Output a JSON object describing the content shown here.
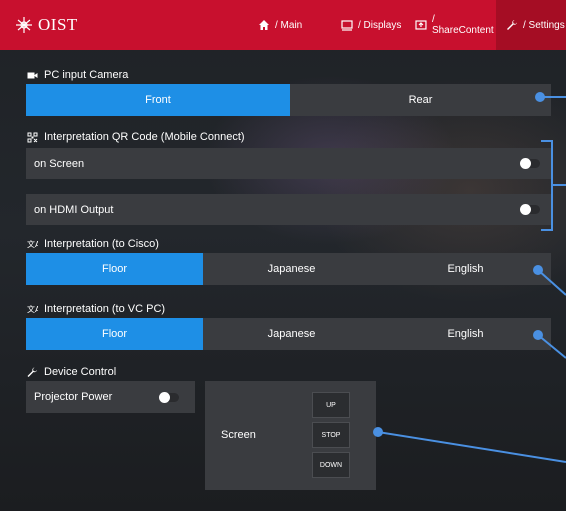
{
  "header": {
    "logo_text": "OIST",
    "nav": [
      {
        "label": "/ Main",
        "icon": "home-icon"
      },
      {
        "label": "/ Displays",
        "icon": "display-icon"
      },
      {
        "label": "/ ShareContent",
        "icon": "share-icon"
      },
      {
        "label": "/ Settings",
        "icon": "wrench-icon",
        "active": true
      }
    ],
    "accent_color": "#c8102e"
  },
  "camera": {
    "title": "PC input Camera",
    "options": [
      "Front",
      "Rear"
    ],
    "selected": "Front"
  },
  "qr": {
    "title": "Interpretation QR Code (Mobile Connect)",
    "toggles": [
      {
        "label": "on Screen",
        "on": true
      },
      {
        "label": "on HDMI Output",
        "on": true
      }
    ]
  },
  "interp_cisco": {
    "title": "Interpretation (to Cisco)",
    "options": [
      "Floor",
      "Japanese",
      "English"
    ],
    "selected": "Floor"
  },
  "interp_vcpc": {
    "title": "Interpretation (to VC PC)",
    "options": [
      "Floor",
      "Japanese",
      "English"
    ],
    "selected": "Floor"
  },
  "device": {
    "title": "Device Control",
    "projector_label": "Projector Power",
    "projector_on": true,
    "screen_label": "Screen",
    "screen_buttons": [
      "UP",
      "STOP",
      "DOWN"
    ]
  },
  "colors": {
    "active_segment": "#1e8fe6",
    "panel": "#3a3c40",
    "annotation": "#4a90e2"
  }
}
